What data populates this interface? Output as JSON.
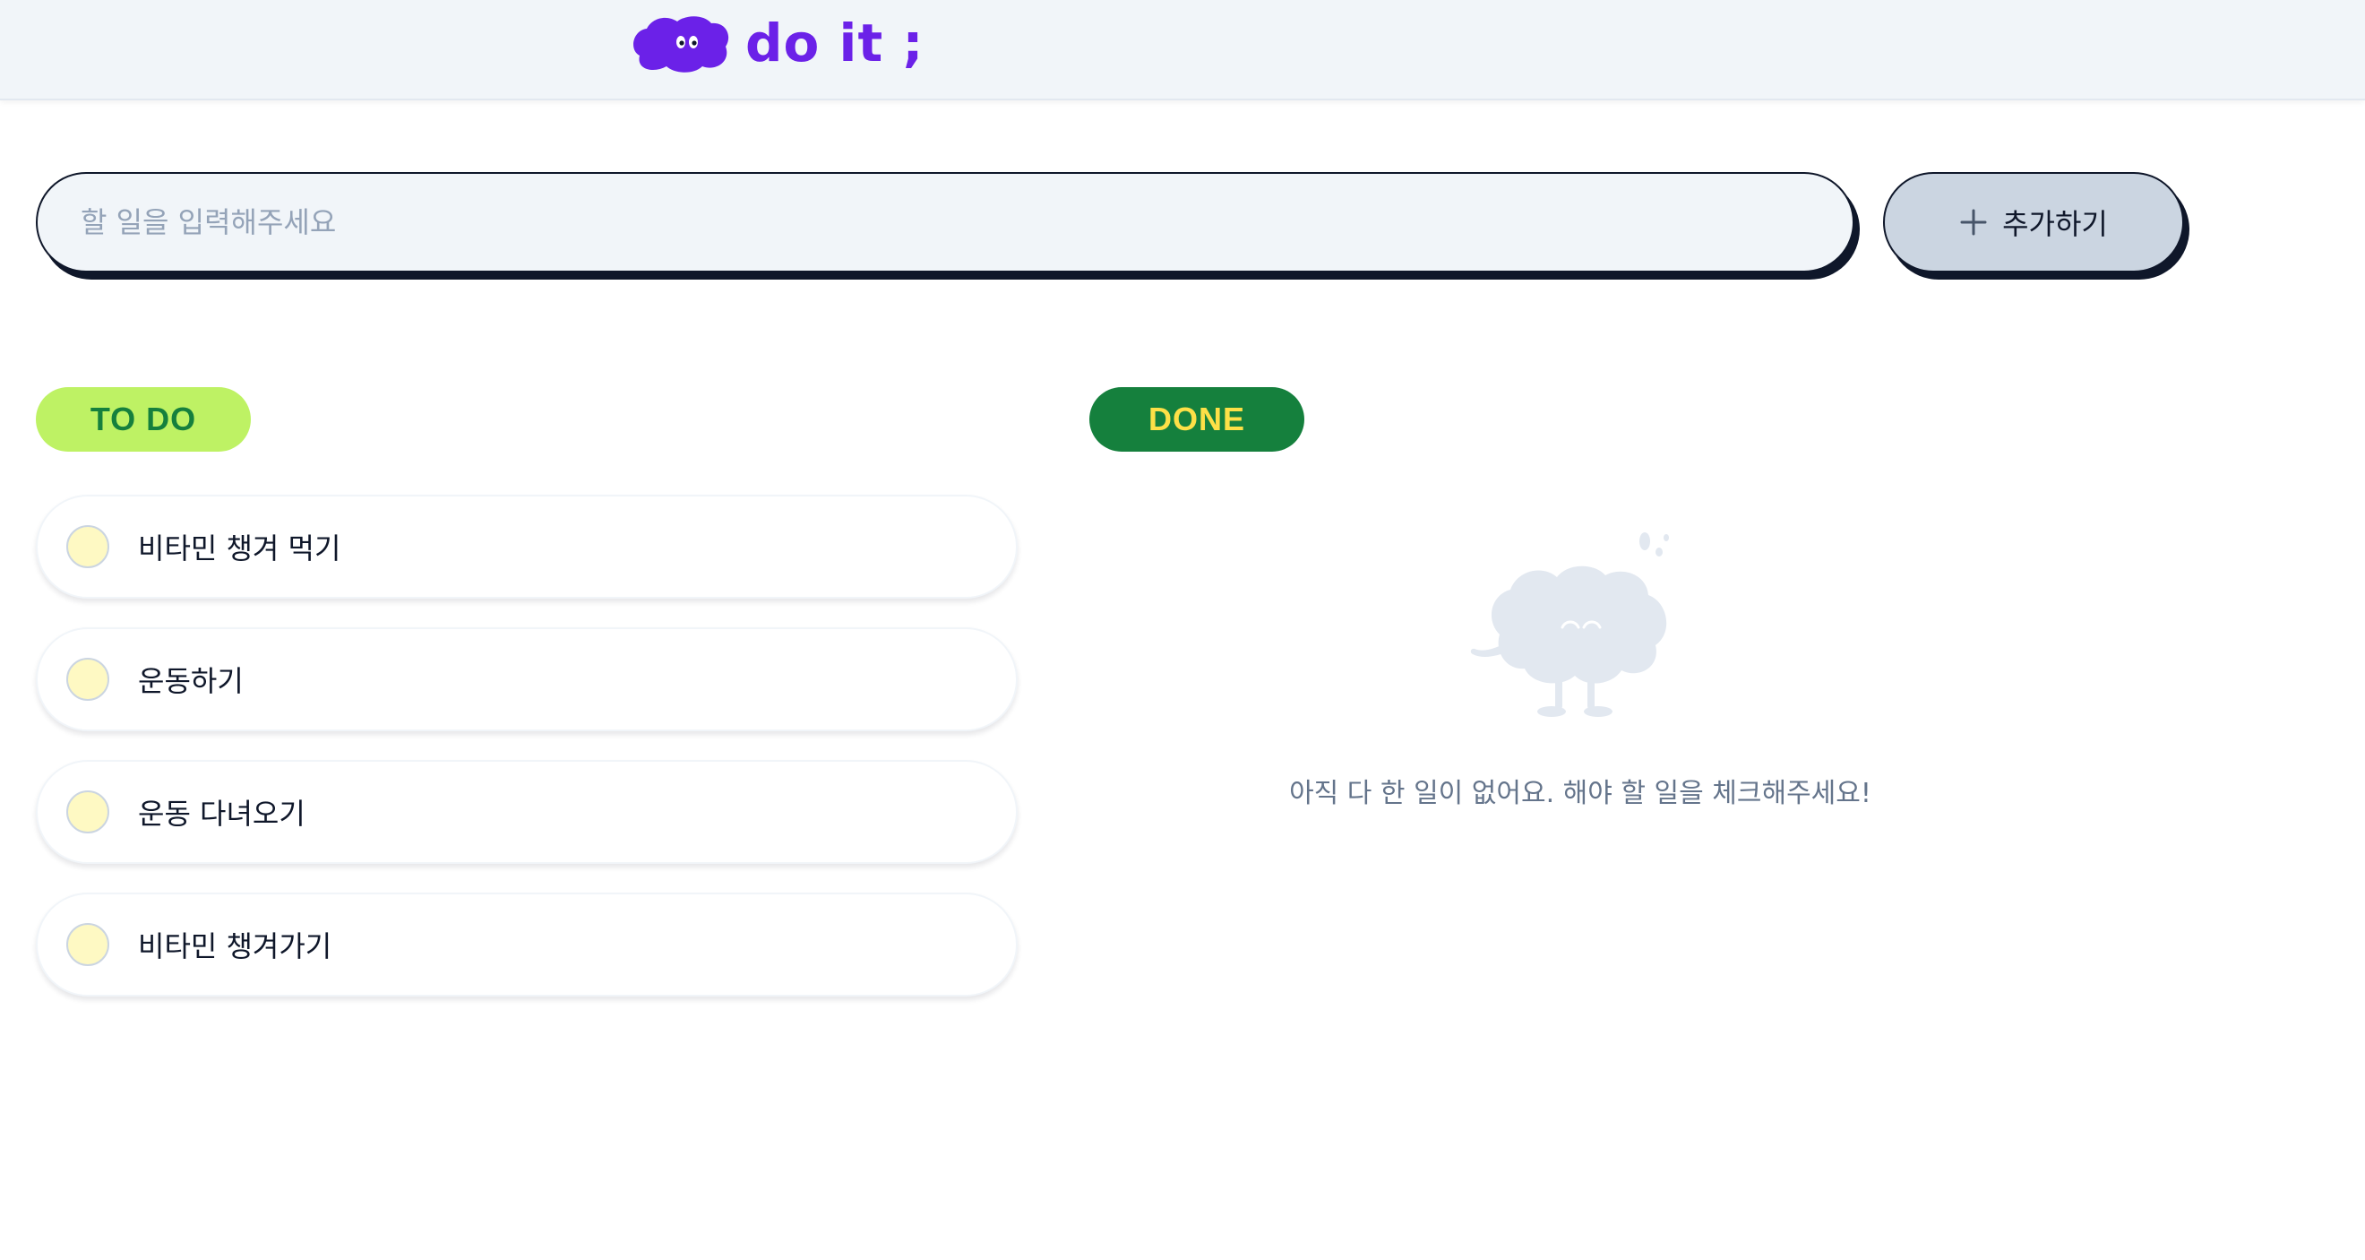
{
  "header": {
    "logo_text": "do it ;",
    "logo_icon": "cloud-mascot-icon",
    "brand_color": "#6b21e8"
  },
  "input": {
    "placeholder": "할 일을 입력해주세요",
    "value": ""
  },
  "add_button": {
    "label": "추가하기",
    "icon": "plus-icon"
  },
  "todo": {
    "badge": "TO DO",
    "badge_bg": "#bef264",
    "badge_color": "#15803d",
    "items": [
      {
        "label": "비타민 챙겨 먹기",
        "checked": false
      },
      {
        "label": "운동하기",
        "checked": false
      },
      {
        "label": "운동 다녀오기",
        "checked": false
      },
      {
        "label": "비타민 챙겨가기",
        "checked": false
      }
    ]
  },
  "done": {
    "badge": "DONE",
    "badge_bg": "#15803d",
    "badge_color": "#fde047",
    "empty_icon": "empty-mascot-icon",
    "empty_message": "아직 다 한 일이 없어요. 해야 할 일을 체크해주세요!"
  }
}
